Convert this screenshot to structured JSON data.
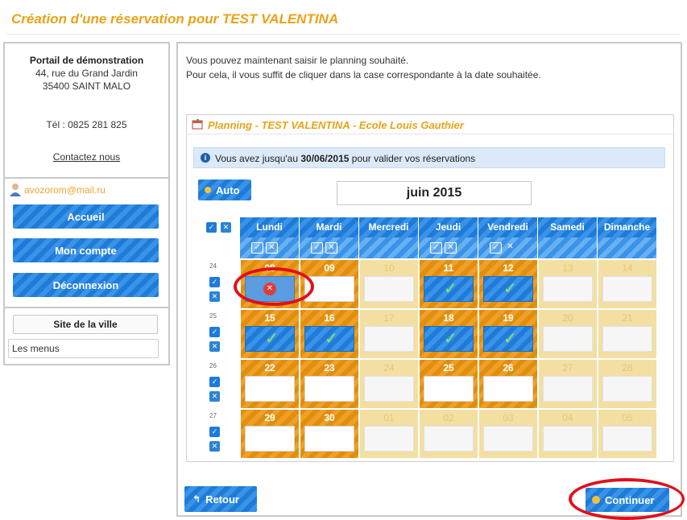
{
  "page": {
    "title": "Création d'une réservation pour TEST VALENTINA"
  },
  "portal": {
    "name": "Portail de démonstration",
    "address_line1": "44, rue du Grand Jardin",
    "address_line2": "35400 SAINT MALO",
    "phone": "Tél : 0825 281 825",
    "contact_link": "Contactez nous"
  },
  "user": {
    "email": "avozorom@mail.ru",
    "avatar_icon": "user-avatar-icon"
  },
  "menu": {
    "accueil": "Accueil",
    "mon_compte": "Mon compte",
    "deconnexion": "Déconnexion"
  },
  "links": {
    "site_ville": "Site de la ville",
    "menus": "Les menus"
  },
  "instructions": {
    "line1": "Vous pouvez maintenant saisir le planning souhaité.",
    "line2": "Pour cela, il vous suffit de cliquer dans la case correspondante à la date souhaitée."
  },
  "planning": {
    "title": "Planning - TEST VALENTINA - Ecole Louis Gauthier",
    "info_prefix": "Vous avez jusqu'au ",
    "info_date": "30/06/2015",
    "info_suffix": " pour valider vos réservations",
    "auto_label": "Auto",
    "month": "juin 2015",
    "days": [
      "Lundi",
      "Mardi",
      "Mercredi",
      "Jeudi",
      "Vendredi",
      "Samedi",
      "Dimanche"
    ],
    "weeks": [
      {
        "num": "24",
        "dates": [
          "08",
          "09",
          "10",
          "11",
          "12",
          "13",
          "14"
        ]
      },
      {
        "num": "25",
        "dates": [
          "15",
          "16",
          "17",
          "18",
          "19",
          "20",
          "21"
        ]
      },
      {
        "num": "26",
        "dates": [
          "22",
          "23",
          "24",
          "25",
          "26",
          "27",
          "28"
        ]
      },
      {
        "num": "27",
        "dates": [
          "29",
          "30",
          "01",
          "02",
          "03",
          "04",
          "05"
        ]
      }
    ]
  },
  "buttons": {
    "retour": "Retour",
    "continuer": "Continuer"
  },
  "colors": {
    "accent_orange": "#e8a317",
    "button_blue": "#1e7bd8",
    "open_day": "#e08e0c",
    "closed_day": "#f3dfa2",
    "highlight_red": "#e0101a"
  }
}
